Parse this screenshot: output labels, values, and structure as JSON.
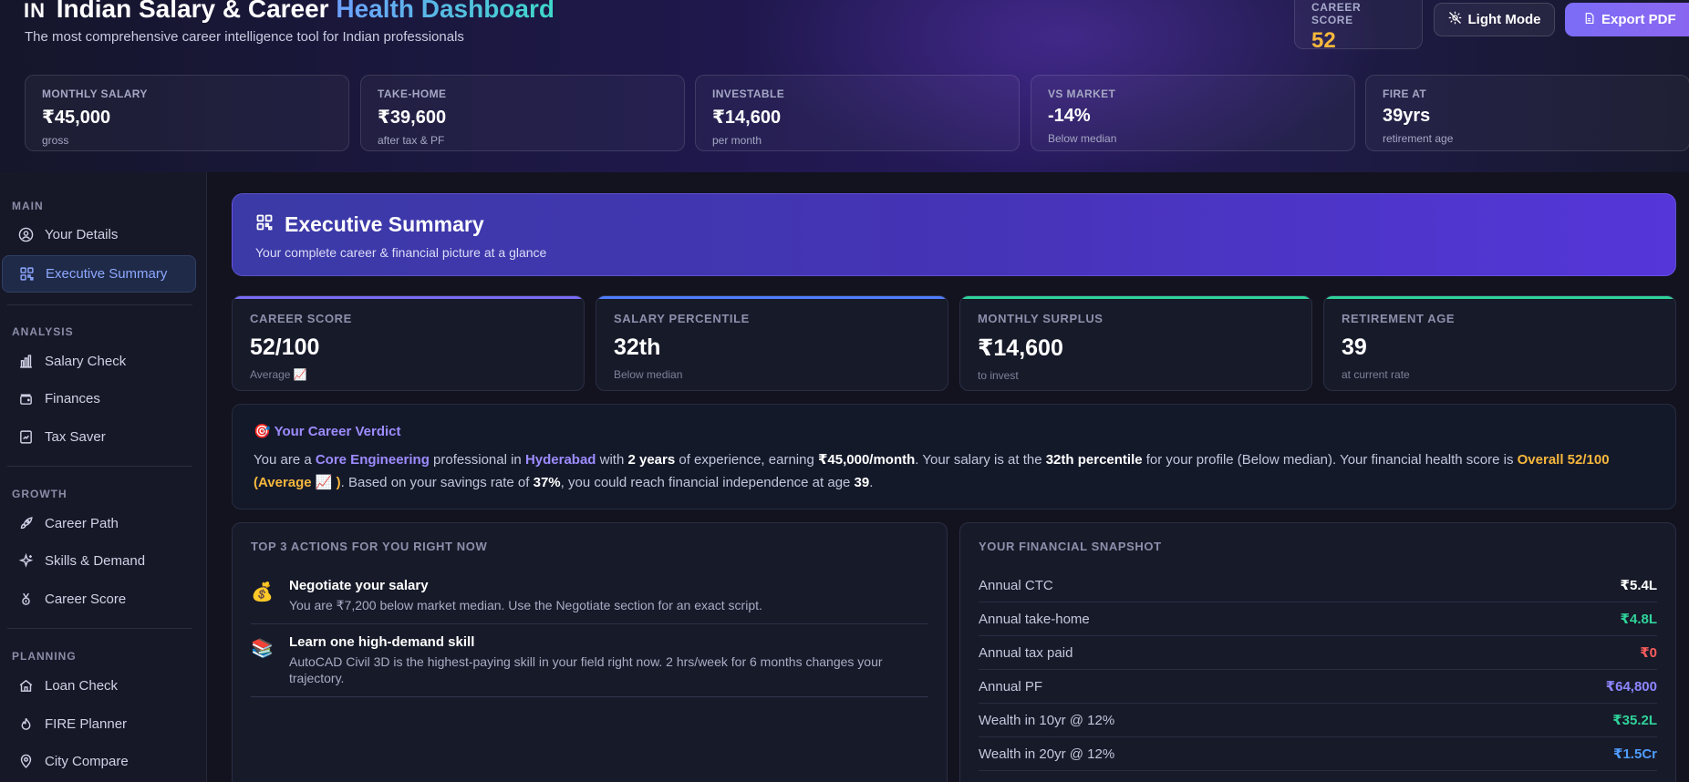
{
  "header": {
    "flag": "IN",
    "title_main": "Indian Salary & Career",
    "title_accent": "Health Dashboard",
    "subtitle": "The most comprehensive career intelligence tool for Indian professionals",
    "career_score_label": "CAREER SCORE",
    "career_score_value": "52",
    "light_mode_label": "Light Mode",
    "export_label": "Export PDF"
  },
  "stats": [
    {
      "label": "MONTHLY SALARY",
      "value": "₹45,000",
      "sub": "gross"
    },
    {
      "label": "TAKE-HOME",
      "value": "₹39,600",
      "sub": "after tax & PF"
    },
    {
      "label": "INVESTABLE",
      "value": "₹14,600",
      "sub": "per month"
    },
    {
      "label": "VS MARKET",
      "value": "-14%",
      "sub": "Below median"
    },
    {
      "label": "FIRE AT",
      "value": "39yrs",
      "sub": "retirement age"
    }
  ],
  "sidebar": {
    "sections": [
      "MAIN",
      "ANALYSIS",
      "GROWTH",
      "PLANNING"
    ],
    "items": [
      {
        "label": "Your Details",
        "icon": "user-icon"
      },
      {
        "label": "Executive Summary",
        "icon": "dashboard-icon"
      },
      {
        "label": "Salary Check",
        "icon": "bar-chart-icon"
      },
      {
        "label": "Finances",
        "icon": "wallet-icon"
      },
      {
        "label": "Tax Saver",
        "icon": "receipt-icon"
      },
      {
        "label": "Career Path",
        "icon": "rocket-icon"
      },
      {
        "label": "Skills & Demand",
        "icon": "sparkles-icon"
      },
      {
        "label": "Career Score",
        "icon": "medal-icon"
      },
      {
        "label": "Loan Check",
        "icon": "home-icon"
      },
      {
        "label": "FIRE Planner",
        "icon": "flame-icon"
      },
      {
        "label": "City Compare",
        "icon": "map-pin-icon"
      }
    ]
  },
  "hero": {
    "title": "Executive Summary",
    "subtitle": "Your complete career & financial picture at a glance"
  },
  "kpis": [
    {
      "label": "CAREER SCORE",
      "value": "52/100",
      "sub": "Average 📈",
      "color": "#7b6cf6"
    },
    {
      "label": "SALARY PERCENTILE",
      "value": "32th",
      "sub": "Below median",
      "color": "#4f7dff"
    },
    {
      "label": "MONTHLY SURPLUS",
      "value": "₹14,600",
      "sub": "to invest",
      "color": "#2fd39a"
    },
    {
      "label": "RETIREMENT AGE",
      "value": "39",
      "sub": "at current rate",
      "color": "#2fd39a"
    }
  ],
  "verdict": {
    "heading": "🎯 Your Career Verdict",
    "t1": "You are a ",
    "field": "Core Engineering",
    "t2": " professional in ",
    "city": "Hyderabad",
    "t3": " with ",
    "years": "2 years",
    "t4": " of experience, earning ",
    "salary": "₹45,000/month",
    "t5": ". Your salary is at the ",
    "percentile": "32th percentile",
    "t6": " for your profile (Below median). Your financial health score is ",
    "score": "Overall 52/100",
    "score2": "(Average 📈 )",
    "t7": ". Based on your savings rate of ",
    "rate": "37%",
    "t8": ", you could reach financial independence at age ",
    "age": "39",
    "t9": "."
  },
  "actions": {
    "title": "TOP 3 ACTIONS FOR YOU RIGHT NOW",
    "items": [
      {
        "emoji": "💰",
        "title": "Negotiate your salary",
        "desc": "You are ₹7,200 below market median. Use the Negotiate section for an exact script."
      },
      {
        "emoji": "📚",
        "title": "Learn one high-demand skill",
        "desc": "AutoCAD Civil 3D is the highest-paying skill in your field right now. 2 hrs/week for 6 months changes your trajectory."
      }
    ]
  },
  "snapshot": {
    "title": "YOUR FINANCIAL SNAPSHOT",
    "rows": [
      {
        "label": "Annual CTC",
        "value": "₹5.4L",
        "color": "#ffffff"
      },
      {
        "label": "Annual take-home",
        "value": "₹4.8L",
        "color": "#2fd39a"
      },
      {
        "label": "Annual tax paid",
        "value": "₹0",
        "color": "#ff5d5d"
      },
      {
        "label": "Annual PF",
        "value": "₹64,800",
        "color": "#8e86ff"
      },
      {
        "label": "Wealth in 10yr @ 12%",
        "value": "₹35.2L",
        "color": "#2fd39a"
      },
      {
        "label": "Wealth in 20yr @ 12%",
        "value": "₹1.5Cr",
        "color": "#4f9dff"
      }
    ]
  }
}
